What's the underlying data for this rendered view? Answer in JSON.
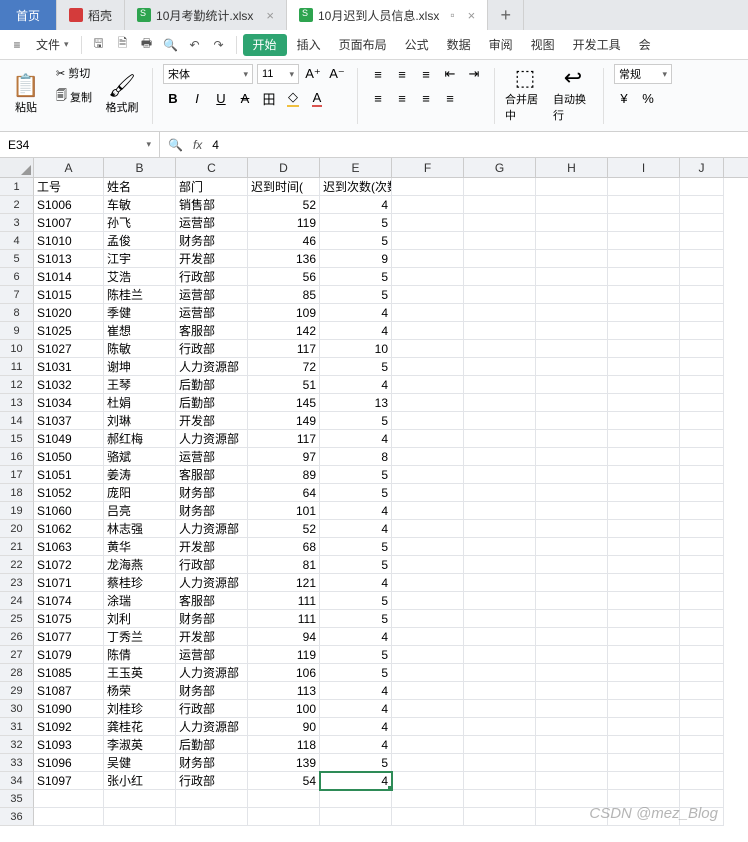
{
  "tabs": {
    "home": "首页",
    "daoke": "稻壳",
    "file1": "10月考勤统计.xlsx",
    "file2": "10月迟到人员信息.xlsx",
    "plus": "+"
  },
  "menu": {
    "file": "文件",
    "items": [
      "开始",
      "插入",
      "页面布局",
      "公式",
      "数据",
      "审阅",
      "视图",
      "开发工具",
      "会"
    ]
  },
  "ribbon": {
    "paste": "粘贴",
    "cut": "剪切",
    "copy": "复制",
    "format_painter": "格式刷",
    "font_name": "宋体",
    "font_size": "11",
    "merge_center": "合并居中",
    "wrap": "自动换行",
    "number_format": "常规"
  },
  "fbar": {
    "cellref": "E34",
    "value": "4"
  },
  "chart_data": {
    "type": "table",
    "columns": [
      "",
      "A",
      "B",
      "C",
      "D",
      "E",
      "F",
      "G",
      "H",
      "I",
      "J"
    ],
    "headers": [
      "工号",
      "姓名",
      "部门",
      "迟到时间(",
      "迟到次数(次数)"
    ],
    "rows": [
      [
        "S1006",
        "车敏",
        "销售部",
        52,
        4
      ],
      [
        "S1007",
        "孙飞",
        "运营部",
        119,
        5
      ],
      [
        "S1010",
        "孟俊",
        "财务部",
        46,
        5
      ],
      [
        "S1013",
        "江宇",
        "开发部",
        136,
        9
      ],
      [
        "S1014",
        "艾浩",
        "行政部",
        56,
        5
      ],
      [
        "S1015",
        "陈桂兰",
        "运营部",
        85,
        5
      ],
      [
        "S1020",
        "季健",
        "运营部",
        109,
        4
      ],
      [
        "S1025",
        "崔想",
        "客服部",
        142,
        4
      ],
      [
        "S1027",
        "陈敏",
        "行政部",
        117,
        10
      ],
      [
        "S1031",
        "谢坤",
        "人力资源部",
        72,
        5
      ],
      [
        "S1032",
        "王琴",
        "后勤部",
        51,
        4
      ],
      [
        "S1034",
        "杜娟",
        "后勤部",
        145,
        13
      ],
      [
        "S1037",
        "刘琳",
        "开发部",
        149,
        5
      ],
      [
        "S1049",
        "郝红梅",
        "人力资源部",
        117,
        4
      ],
      [
        "S1050",
        "骆斌",
        "运营部",
        97,
        8
      ],
      [
        "S1051",
        "姜涛",
        "客服部",
        89,
        5
      ],
      [
        "S1052",
        "庞阳",
        "财务部",
        64,
        5
      ],
      [
        "S1060",
        "吕亮",
        "财务部",
        101,
        4
      ],
      [
        "S1062",
        "林志强",
        "人力资源部",
        52,
        4
      ],
      [
        "S1063",
        "黄华",
        "开发部",
        68,
        5
      ],
      [
        "S1072",
        "龙海燕",
        "行政部",
        81,
        5
      ],
      [
        "S1071",
        "蔡桂珍",
        "人力资源部",
        121,
        4
      ],
      [
        "S1074",
        "涂瑞",
        "客服部",
        111,
        5
      ],
      [
        "S1075",
        "刘利",
        "财务部",
        111,
        5
      ],
      [
        "S1077",
        "丁秀兰",
        "开发部",
        94,
        4
      ],
      [
        "S1079",
        "陈倩",
        "运营部",
        119,
        5
      ],
      [
        "S1085",
        "王玉英",
        "人力资源部",
        106,
        5
      ],
      [
        "S1087",
        "杨荣",
        "财务部",
        113,
        4
      ],
      [
        "S1090",
        "刘桂珍",
        "行政部",
        100,
        4
      ],
      [
        "S1092",
        "龚桂花",
        "人力资源部",
        90,
        4
      ],
      [
        "S1093",
        "李淑英",
        "后勤部",
        118,
        4
      ],
      [
        "S1096",
        "吴健",
        "财务部",
        139,
        5
      ],
      [
        "S1097",
        "张小红",
        "行政部",
        54,
        4
      ]
    ]
  },
  "watermark": "CSDN @mez_Blog"
}
